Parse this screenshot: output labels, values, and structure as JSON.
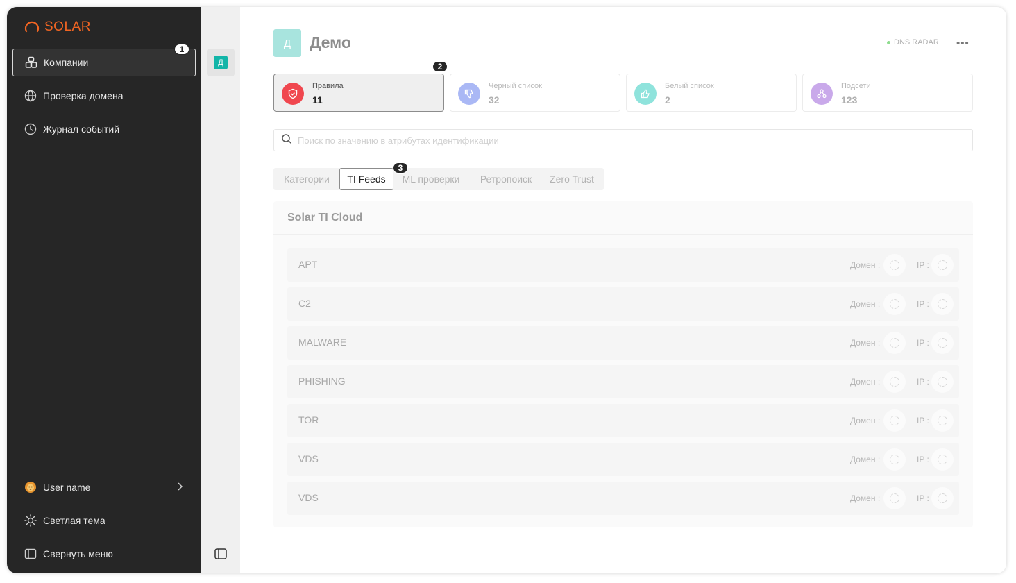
{
  "sidebar": {
    "logo": "SOLAR",
    "items": [
      {
        "label": "Компании",
        "icon": "building-icon"
      },
      {
        "label": "Проверка домена",
        "icon": "globe-icon"
      },
      {
        "label": "Журнал событий",
        "icon": "clock-icon"
      }
    ],
    "footer": {
      "user": "User name",
      "theme": "Светлая тема",
      "collapse": "Свернуть меню"
    }
  },
  "annotations": [
    "1",
    "2",
    "3"
  ],
  "rail": {
    "avatar": "Д"
  },
  "header": {
    "avatar": "Д",
    "title": "Демо",
    "status": "DNS RADAR",
    "more": "•••"
  },
  "stats": [
    {
      "label": "Правила",
      "value": "11",
      "color": "#f0474f"
    },
    {
      "label": "Черный список",
      "value": "32",
      "color": "#aab8f5"
    },
    {
      "label": "Белый список",
      "value": "2",
      "color": "#8fe3dc"
    },
    {
      "label": "Подсети",
      "value": "123",
      "color": "#c9a9ea"
    }
  ],
  "search": {
    "placeholder": "Поиск по значению в атрибутах идентификации"
  },
  "tabs": [
    "Категории",
    "TI Feeds",
    "ML проверки",
    "Ретропоиск",
    "Zero Trust"
  ],
  "panel": {
    "title": "Solar TI Cloud",
    "domain_label": "Домен :",
    "ip_label": "IP :",
    "feeds": [
      "APT",
      "C2",
      "MALWARE",
      "PHISHING",
      "TOR",
      "VDS",
      "VDS"
    ]
  }
}
